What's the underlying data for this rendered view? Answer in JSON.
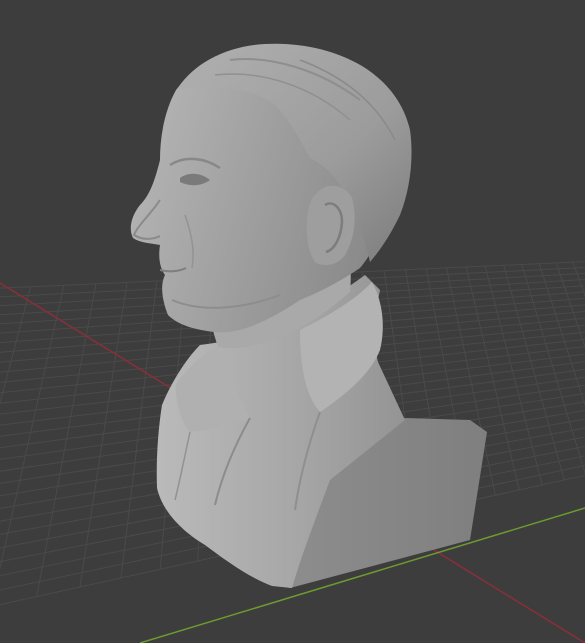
{
  "viewport": {
    "background_color": "#3d3d3d",
    "grid_color": "#4a4a4a",
    "x_axis_color": "#8b2e3a",
    "y_axis_color": "#6e9a30",
    "shaded_object": "bust-sculpture",
    "object_color": "#9a9a9a"
  }
}
